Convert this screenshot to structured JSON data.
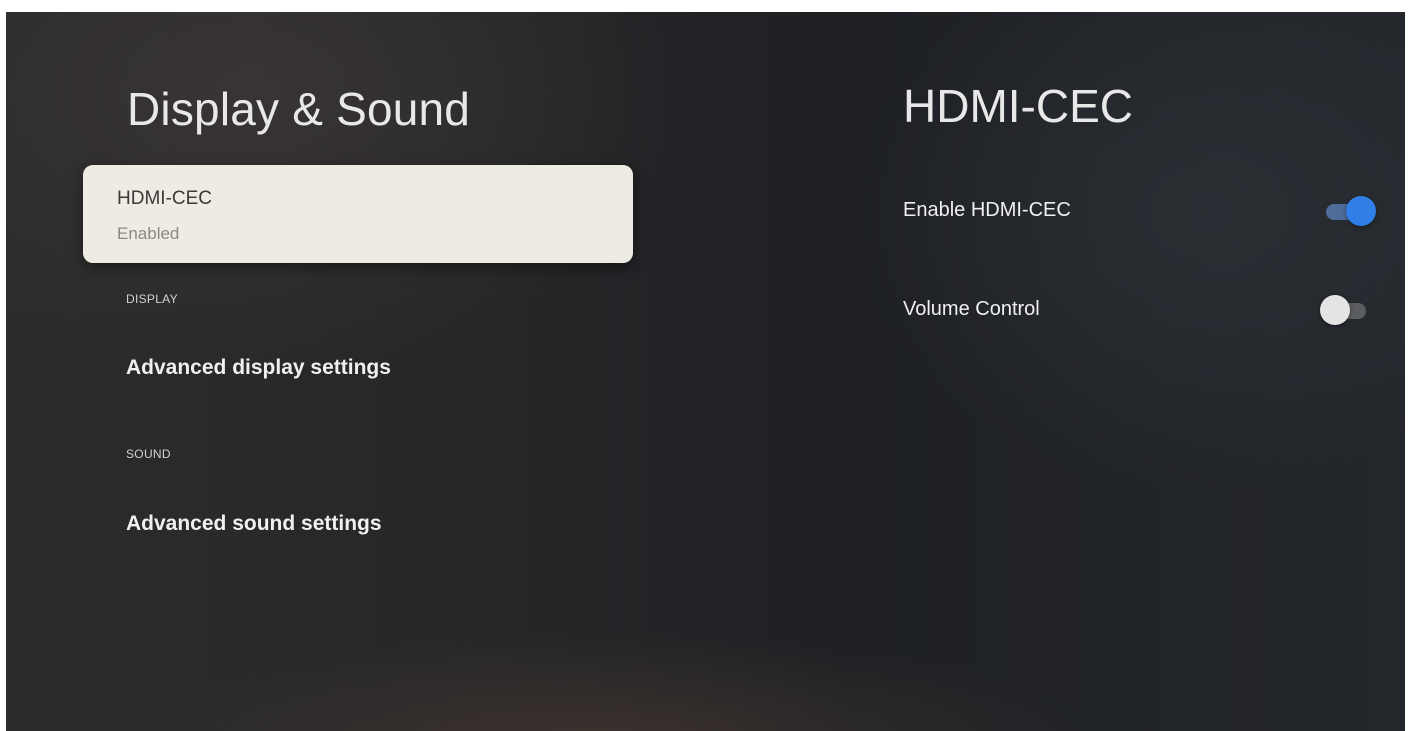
{
  "left_pane": {
    "title": "Display & Sound",
    "selected_item": {
      "title": "HDMI-CEC",
      "subtitle": "Enabled"
    },
    "sections": [
      {
        "label": "DISPLAY",
        "item": "Advanced display settings"
      },
      {
        "label": "SOUND",
        "item": "Advanced sound settings"
      }
    ]
  },
  "right_pane": {
    "title": "HDMI-CEC",
    "settings": [
      {
        "label": "Enable HDMI-CEC",
        "toggle": "on",
        "toggle_color": "#2f7fe6"
      },
      {
        "label": "Volume Control",
        "toggle": "off",
        "toggle_color": "#e4e4e4"
      }
    ]
  }
}
